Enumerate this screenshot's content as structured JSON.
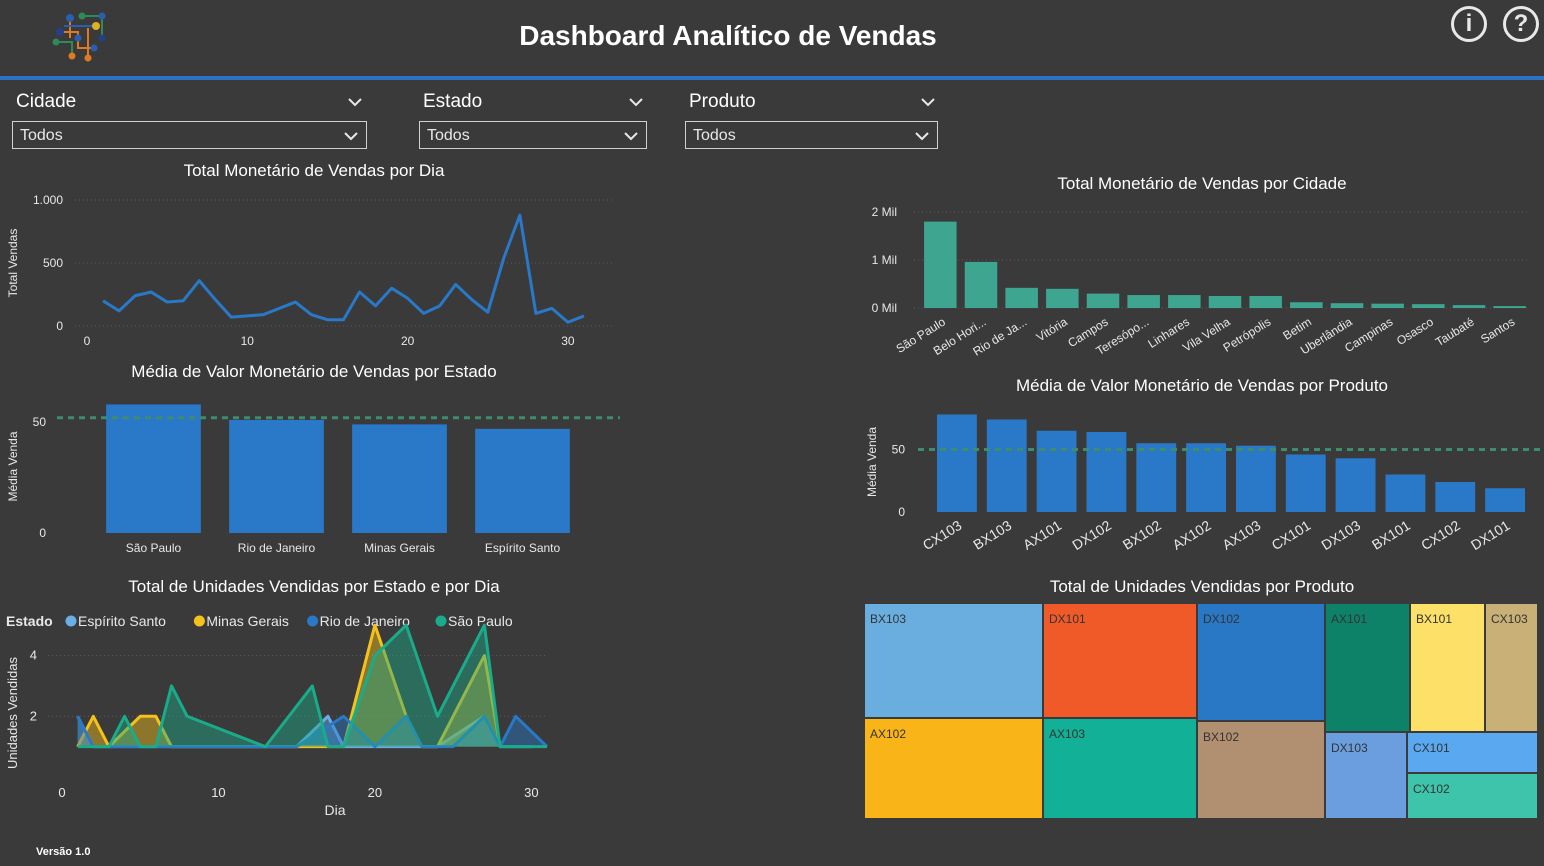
{
  "header": {
    "title": "Dashboard Analítico de Vendas",
    "info_icon": "info-icon",
    "help_icon": "help-icon",
    "info_label": "i",
    "help_label": "?",
    "logo_icon": "network-logo-icon"
  },
  "filters": [
    {
      "label": "Cidade",
      "value": "Todos"
    },
    {
      "label": "Estado",
      "value": "Todos"
    },
    {
      "label": "Produto",
      "value": "Todos"
    }
  ],
  "footer": {
    "version": "Versão 1.0"
  },
  "colors": {
    "blue": "#2979c8",
    "teal": "#3da590",
    "background": "#3a3a3a",
    "accent": "#2b73c2"
  },
  "chart_data": [
    {
      "id": "sales_by_day",
      "type": "line",
      "title": "Total Monetário de Vendas por Dia",
      "ylabel": "Total Vendas",
      "xlabel": "",
      "x": [
        1,
        2,
        3,
        4,
        5,
        6,
        7,
        8,
        9,
        10,
        11,
        12,
        13,
        14,
        15,
        16,
        17,
        18,
        19,
        20,
        21,
        22,
        23,
        24,
        25,
        26,
        27,
        28,
        29,
        30,
        31
      ],
      "values": [
        200,
        120,
        240,
        270,
        190,
        200,
        360,
        210,
        70,
        80,
        90,
        140,
        190,
        90,
        50,
        50,
        270,
        160,
        300,
        220,
        100,
        160,
        330,
        210,
        110,
        540,
        880,
        100,
        140,
        30,
        80
      ],
      "xticks": [
        "0",
        "10",
        "20",
        "30"
      ],
      "yticks": [
        "0",
        "500",
        "1.000"
      ],
      "ylim": [
        0,
        1000
      ],
      "xlim": [
        0,
        32
      ],
      "color": "#2979c8"
    },
    {
      "id": "avg_by_state",
      "type": "bar",
      "title": "Média de Valor Monetário de Vendas por Estado",
      "ylabel": "Média Venda",
      "categories": [
        "São Paulo",
        "Rio de Janeiro",
        "Minas Gerais",
        "Espírito Santo"
      ],
      "values": [
        58,
        51,
        49,
        47
      ],
      "yticks": [
        "0",
        "50"
      ],
      "ylim": [
        0,
        60
      ],
      "average_line": 52,
      "color": "#2979c8"
    },
    {
      "id": "units_by_state_day",
      "type": "area",
      "title": "Total de Unidades Vendidas por Estado e por Dia",
      "ylabel": "Unidades Vendidas",
      "xlabel": "Dia",
      "legend_title": "Estado",
      "xticks": [
        "0",
        "10",
        "20",
        "30"
      ],
      "yticks": [
        "2",
        "4"
      ],
      "ylim": [
        0,
        5.5
      ],
      "xlim": [
        0,
        31
      ],
      "series": [
        {
          "name": "Espírito Santo",
          "color": "#6aaee8",
          "points": [
            [
              1,
              2
            ],
            [
              2,
              1
            ],
            [
              4,
              1
            ],
            [
              5,
              1
            ],
            [
              7,
              1
            ],
            [
              12,
              1
            ],
            [
              15,
              1
            ],
            [
              17,
              2
            ],
            [
              18,
              1
            ],
            [
              22,
              1
            ],
            [
              24,
              1
            ],
            [
              27,
              2
            ],
            [
              28,
              1
            ],
            [
              30,
              1
            ]
          ]
        },
        {
          "name": "Minas Gerais",
          "color": "#f5c21b",
          "points": [
            [
              1,
              1
            ],
            [
              2,
              2
            ],
            [
              3,
              1
            ],
            [
              5,
              2
            ],
            [
              6,
              2
            ],
            [
              7,
              1
            ],
            [
              10,
              1
            ],
            [
              18,
              1
            ],
            [
              19,
              3
            ],
            [
              20,
              5
            ],
            [
              22,
              2
            ],
            [
              23,
              1
            ],
            [
              24,
              1
            ],
            [
              27,
              4
            ],
            [
              28,
              1
            ]
          ]
        },
        {
          "name": "Rio de Janeiro",
          "color": "#2979c8",
          "points": [
            [
              1,
              2
            ],
            [
              2,
              1
            ],
            [
              3,
              1
            ],
            [
              4,
              1
            ],
            [
              6,
              1
            ],
            [
              7,
              1
            ],
            [
              13,
              1
            ],
            [
              15,
              1
            ],
            [
              18,
              2
            ],
            [
              20,
              1
            ],
            [
              22,
              2
            ],
            [
              23,
              1
            ],
            [
              25,
              1
            ],
            [
              27,
              2
            ],
            [
              28,
              1
            ],
            [
              29,
              2
            ],
            [
              31,
              1
            ]
          ]
        },
        {
          "name": "São Paulo",
          "color": "#1aab8a",
          "points": [
            [
              1,
              1
            ],
            [
              3,
              1
            ],
            [
              4,
              2
            ],
            [
              5,
              1
            ],
            [
              6,
              1
            ],
            [
              7,
              3
            ],
            [
              8,
              2
            ],
            [
              13,
              1
            ],
            [
              16,
              3
            ],
            [
              17,
              1
            ],
            [
              18,
              1
            ],
            [
              20,
              4
            ],
            [
              22,
              5
            ],
            [
              24,
              2
            ],
            [
              27,
              5
            ],
            [
              28,
              1
            ],
            [
              31,
              1
            ]
          ]
        }
      ]
    },
    {
      "id": "sales_by_city",
      "type": "bar",
      "title": "Total Monetário de Vendas por Cidade",
      "ylabel": "",
      "categories": [
        "São Paulo",
        "Belo Hori...",
        "Rio de Ja...",
        "Vitória",
        "Campos",
        "Teresópo...",
        "Linhares",
        "Vila Velha",
        "Petrópolis",
        "Betim",
        "Uberlândia",
        "Campinas",
        "Osasco",
        "Taubaté",
        "Santos"
      ],
      "values": [
        1.8,
        0.96,
        0.42,
        0.4,
        0.3,
        0.27,
        0.27,
        0.25,
        0.25,
        0.12,
        0.1,
        0.09,
        0.08,
        0.06,
        0.04
      ],
      "yticks": [
        "0 Mil",
        "1 Mil",
        "2 Mil"
      ],
      "ylim": [
        0,
        2
      ],
      "color": "#3da590"
    },
    {
      "id": "avg_by_product",
      "type": "bar",
      "title": "Média de Valor Monetário de Vendas por Produto",
      "ylabel": "Média Venda",
      "categories": [
        "CX103",
        "BX103",
        "AX101",
        "DX102",
        "BX102",
        "AX102",
        "AX103",
        "CX101",
        "DX103",
        "BX101",
        "CX102",
        "DX101"
      ],
      "values": [
        78,
        74,
        65,
        64,
        55,
        55,
        53,
        46,
        43,
        30,
        24,
        19
      ],
      "yticks": [
        "0",
        "50"
      ],
      "ylim": [
        0,
        80
      ],
      "average_line": 50,
      "color": "#2979c8"
    },
    {
      "id": "units_by_product",
      "type": "treemap",
      "title": "Total de Unidades Vendidas por Produto",
      "items": [
        {
          "name": "BX103",
          "color": "#6aaee0"
        },
        {
          "name": "AX102",
          "color": "#f9b418"
        },
        {
          "name": "DX101",
          "color": "#f05a28"
        },
        {
          "name": "AX103",
          "color": "#12b096"
        },
        {
          "name": "DX102",
          "color": "#2878c6"
        },
        {
          "name": "BX102",
          "color": "#b09070"
        },
        {
          "name": "AX101",
          "color": "#0e8268"
        },
        {
          "name": "DX103",
          "color": "#6a9ede"
        },
        {
          "name": "BX101",
          "color": "#fde068"
        },
        {
          "name": "CX103",
          "color": "#c9b076"
        },
        {
          "name": "CX101",
          "color": "#5aa8f0"
        },
        {
          "name": "CX102",
          "color": "#3ec4aa"
        }
      ]
    }
  ]
}
